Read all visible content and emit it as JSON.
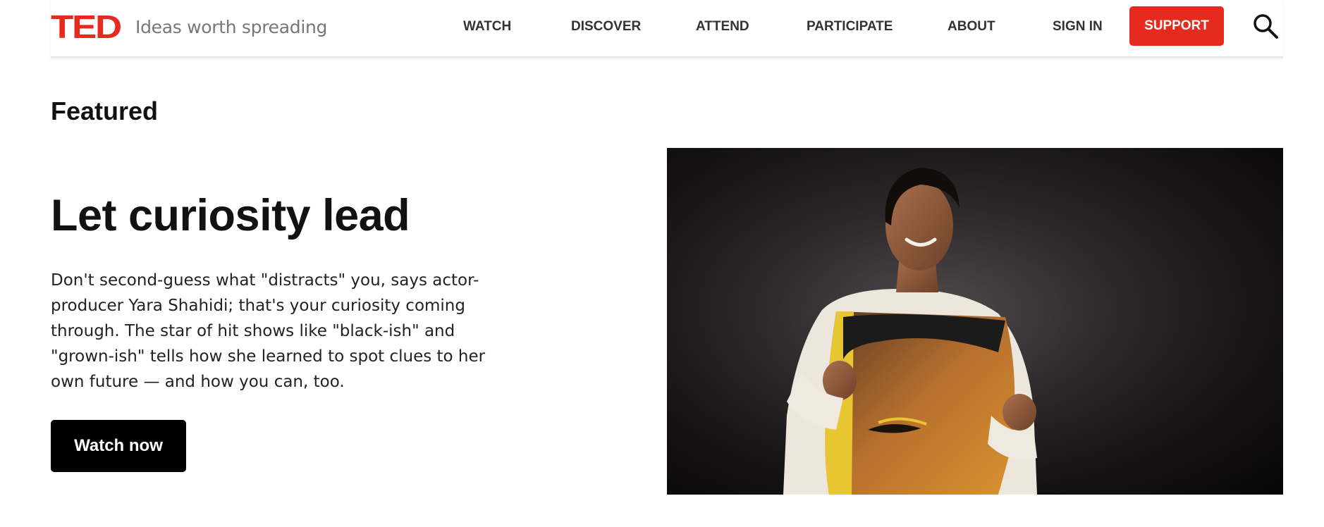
{
  "header": {
    "logo": "TED",
    "tagline": "Ideas worth spreading",
    "nav": [
      {
        "label": "WATCH"
      },
      {
        "label": "DISCOVER"
      },
      {
        "label": "ATTEND"
      },
      {
        "label": "PARTICIPATE"
      },
      {
        "label": "ABOUT"
      },
      {
        "label": "SIGN IN"
      }
    ],
    "support_label": "SUPPORT",
    "search_icon": "search-icon"
  },
  "featured": {
    "section_title": "Featured",
    "headline": "Let curiosity lead",
    "description": "Don't second-guess what \"distracts\" you, says actor-producer Yara Shahidi; that's your curiosity coming through. The star of hit shows like \"black-ish\" and \"grown-ish\" tells how she learned to spot clues to her own future — and how you can, too.",
    "cta_label": "Watch now"
  },
  "colors": {
    "brand_red": "#e62b1e",
    "cta_black": "#000000",
    "nav_text": "#333333"
  }
}
